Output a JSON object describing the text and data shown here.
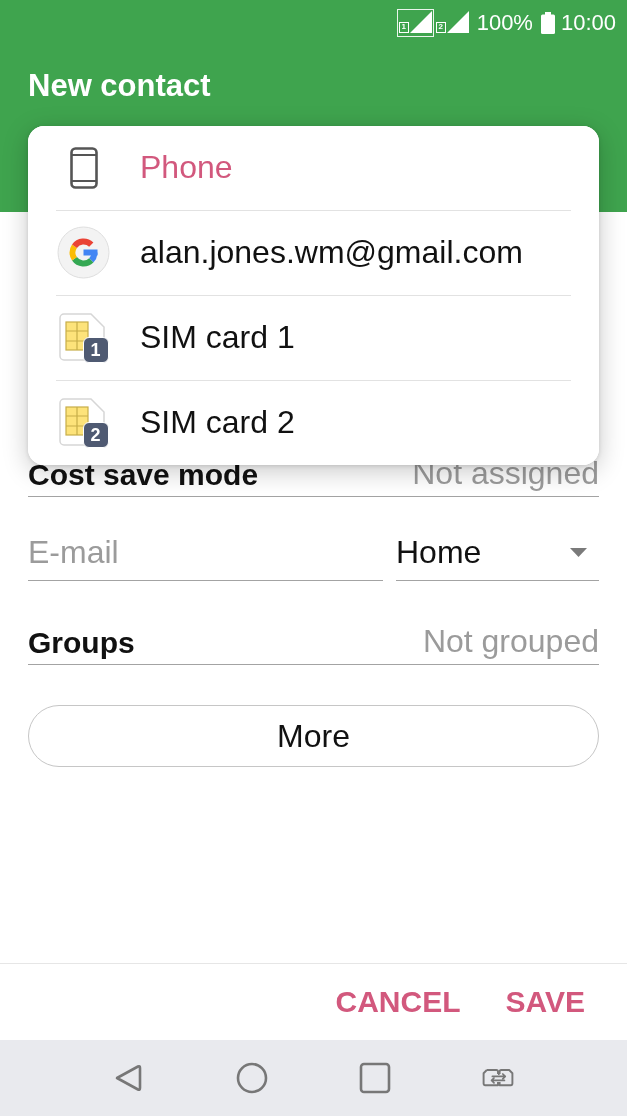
{
  "status_bar": {
    "sims": [
      {
        "label": "1",
        "active": true
      },
      {
        "label": "2",
        "active": false
      }
    ],
    "battery": "100%",
    "time": "10:00"
  },
  "header": {
    "title": "New contact"
  },
  "account_menu": {
    "options": [
      {
        "kind": "phone",
        "label": "Phone",
        "selected": true
      },
      {
        "kind": "google",
        "label": "alan.jones.wm@gmail.com",
        "selected": false
      },
      {
        "kind": "sim",
        "label": "SIM card 1",
        "badge": "1",
        "selected": false
      },
      {
        "kind": "sim",
        "label": "SIM card 2",
        "badge": "2",
        "selected": false
      }
    ]
  },
  "form": {
    "fields": [
      {
        "kind": "setting",
        "label": "Cost save mode",
        "value": "Not assigned"
      },
      {
        "kind": "input",
        "placeholder": "E-mail",
        "type": "Home"
      },
      {
        "kind": "setting",
        "label": "Groups",
        "value": "Not grouped"
      }
    ],
    "more_button": "More"
  },
  "actions": {
    "cancel": "CANCEL",
    "save": "SAVE"
  }
}
